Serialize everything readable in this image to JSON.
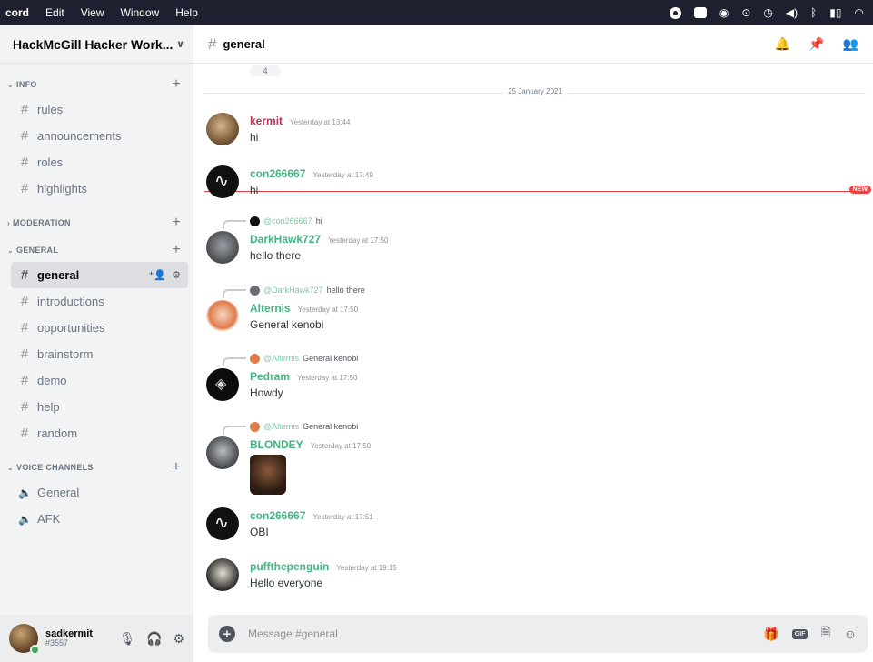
{
  "menubar": {
    "app": "cord",
    "items": [
      "Edit",
      "View",
      "Window",
      "Help"
    ],
    "tray_icons": [
      "record-icon",
      "window-icon",
      "app-icon",
      "target-icon",
      "clock-icon",
      "volume-icon",
      "bluetooth-icon",
      "battery-icon",
      "wifi-icon"
    ]
  },
  "server": {
    "name": "HackMcGill Hacker Work..."
  },
  "categories": {
    "info": "INFO",
    "moderation": "MODERATION",
    "general": "GENERAL",
    "voice": "VOICE CHANNELS"
  },
  "channels": {
    "info": [
      "rules",
      "announcements",
      "roles",
      "highlights"
    ],
    "general": [
      "general",
      "introductions",
      "opportunities",
      "brainstorm",
      "demo",
      "help",
      "random"
    ],
    "voice": [
      "General",
      "AFK"
    ]
  },
  "user": {
    "name": "sadkermit",
    "discriminator": "#3557"
  },
  "header": {
    "channel": "general"
  },
  "date_divider": "25 January 2021",
  "new_badge": "NEW",
  "reaction": "4",
  "messages": [
    {
      "author": "kermit",
      "time": "Yesterday at 13:44",
      "text": "hi",
      "color": "#b83253"
    },
    {
      "author": "con266667",
      "time": "Yesterday at 17:49",
      "text": "hi",
      "color": "#43b581"
    },
    {
      "author": "DarkHawk727",
      "time": "Yesterday at 17:50",
      "text": "hello there",
      "color": "#43b581",
      "reply_name": "@con266667",
      "reply_text": "hi"
    },
    {
      "author": "Alternis",
      "time": "Yesterday at 17:50",
      "text": "General kenobi",
      "color": "#43b581",
      "reply_name": "@DarkHawk727",
      "reply_text": "hello there"
    },
    {
      "author": "Pedram",
      "time": "Yesterday at 17:50",
      "text": "Howdy",
      "color": "#43b581",
      "reply_name": "@Alternis",
      "reply_text": "General kenobi"
    },
    {
      "author": "BLONDEY",
      "time": "Yesterday at 17:50",
      "text": "",
      "color": "#43b581",
      "reply_name": "@Alternis",
      "reply_text": "General kenobi"
    },
    {
      "author": "con266667",
      "time": "Yesterday at 17:51",
      "text": "OBI",
      "color": "#43b581"
    },
    {
      "author": "puffthepenguin",
      "time": "Yesterday at 19:15",
      "text": "Hello everyone",
      "color": "#43b581"
    }
  ],
  "composer": {
    "placeholder": "Message #general"
  }
}
